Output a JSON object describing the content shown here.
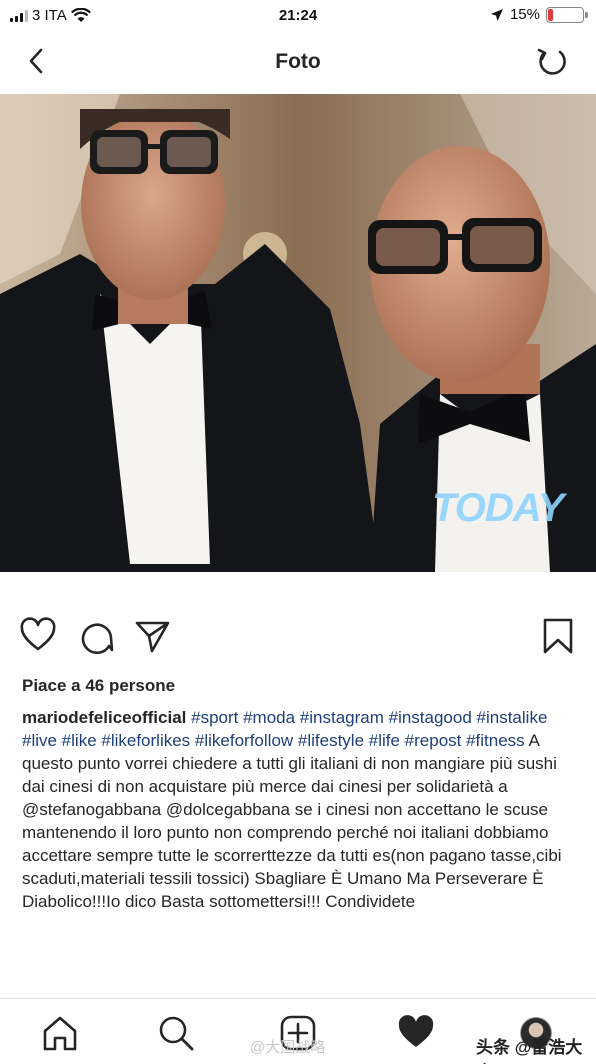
{
  "status_bar": {
    "carrier": "3 ITA",
    "time": "21:24",
    "battery_percent": "15%",
    "battery_level": 0.15,
    "battery_color": "#e23b3b"
  },
  "nav": {
    "title": "Foto",
    "back_icon": "chevron-left-icon",
    "refresh_icon": "refresh-icon"
  },
  "photo": {
    "watermark": "TODAY"
  },
  "actions": {
    "like_icon": "heart-icon",
    "comment_icon": "comment-icon",
    "share_icon": "send-icon",
    "save_icon": "bookmark-icon"
  },
  "post": {
    "likes": "Piace a 46 persone",
    "username": "mariodefeliceofficial",
    "hashtags": "#sport #moda #instagram #instagood #instalike #live #like #likeforlikes #likeforfollow #lifestyle #life #repost #fitness",
    "caption": "A questo punto vorrei chiedere a tutti gli italiani di non mangiare più sushi dai cinesi di non acquistare più merce dai cinesi per solidarietà a @stefanogabbana @dolcegabbana se i cinesi non accettano le scuse mantenendo il loro punto non comprendo perché noi italiani dobbiamo accettare sempre tutte le scorrerttezze da tutti es(non pagano tasse,cibi scaduti,materiali tessili tossici) Sbagliare È Umano Ma Perseverare È Diabolico!!!Io dico Basta sottomettersi!!! Condividete"
  },
  "tab_bar": {
    "home_icon": "home-icon",
    "search_icon": "search-icon",
    "add_icon": "add-post-icon",
    "activity_icon": "heart-filled-icon",
    "profile_icon": "avatar"
  },
  "overlays": {
    "weibo_watermark": "@大国战略",
    "toutiao_watermark": "头条 @雷浩大大"
  }
}
